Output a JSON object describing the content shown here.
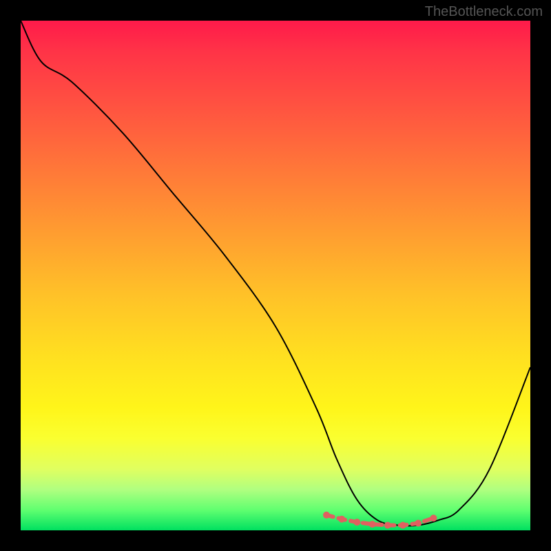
{
  "watermark": "TheBottleneck.com",
  "chart_data": {
    "type": "line",
    "title": "",
    "xlabel": "",
    "ylabel": "",
    "xlim": [
      0,
      100
    ],
    "ylim": [
      0,
      100
    ],
    "series": [
      {
        "name": "curve",
        "x": [
          0,
          4,
          10,
          20,
          30,
          40,
          50,
          58,
          62,
          66,
          70,
          74,
          78,
          82,
          86,
          92,
          100
        ],
        "values": [
          100,
          92,
          88,
          78,
          66,
          54,
          40,
          24,
          14,
          6,
          2,
          1,
          1,
          2,
          4,
          12,
          32
        ]
      }
    ],
    "highlight": {
      "name": "bottom-marks",
      "color": "#e06060",
      "x": [
        60,
        63,
        66,
        69,
        72,
        75,
        78,
        81
      ],
      "values": [
        3.0,
        2.2,
        1.6,
        1.2,
        1.0,
        1.0,
        1.4,
        2.4
      ]
    }
  }
}
